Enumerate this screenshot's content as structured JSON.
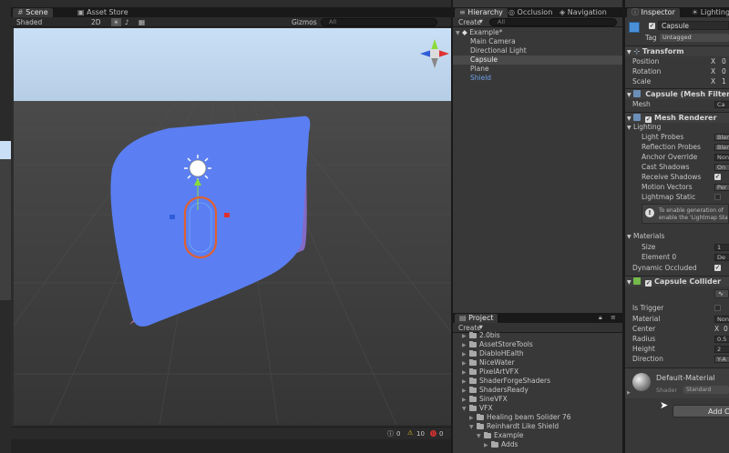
{
  "scene": {
    "tabs": [
      {
        "label": "Scene"
      },
      {
        "label": "Asset Store"
      }
    ],
    "toolbar": {
      "shading": "Shaded",
      "mode_2d": "2D",
      "gizmos": "Gizmos",
      "search_placeholder": "All"
    },
    "status_counts": {
      "messages": "0",
      "warnings": "10",
      "errors": "0"
    }
  },
  "hierarchy": {
    "tabs": [
      {
        "label": "Hierarchy"
      },
      {
        "label": "Occlusion"
      },
      {
        "label": "Navigation"
      }
    ],
    "create_label": "Create",
    "search_placeholder": "All",
    "scene_name": "Example*",
    "items": [
      {
        "label": "Main Camera"
      },
      {
        "label": "Directional Light"
      },
      {
        "label": "Capsule"
      },
      {
        "label": "Plane"
      },
      {
        "label": "Shield"
      }
    ]
  },
  "project": {
    "tab_label": "Project",
    "create_label": "Create",
    "folders": [
      {
        "label": "2.0bis"
      },
      {
        "label": "AssetStoreTools"
      },
      {
        "label": "DiabloHEalth"
      },
      {
        "label": "NiceWater"
      },
      {
        "label": "PixelArtVFX"
      },
      {
        "label": "ShaderForgeShaders"
      },
      {
        "label": "ShadersReady"
      },
      {
        "label": "SineVFX"
      },
      {
        "label": "VFX"
      },
      {
        "label": "Healing beam Solider 76"
      },
      {
        "label": "Reinhardt Like Shield"
      },
      {
        "label": "Example"
      },
      {
        "label": "Adds"
      }
    ]
  },
  "inspector": {
    "tabs": [
      {
        "label": "Inspector"
      },
      {
        "label": "Lighting"
      }
    ],
    "object_name": "Capsule",
    "tag_label": "Tag",
    "tag_value": "Untagged",
    "transform": {
      "title": "Transform",
      "rows": [
        {
          "label": "Position",
          "axis": "X",
          "value": "0"
        },
        {
          "label": "Rotation",
          "axis": "X",
          "value": "0"
        },
        {
          "label": "Scale",
          "axis": "X",
          "value": "1"
        }
      ]
    },
    "mesh_filter": {
      "title": "Capsule (Mesh Filter)",
      "mesh_label": "Mesh",
      "mesh_value": "Ca"
    },
    "mesh_renderer": {
      "title": "Mesh Renderer",
      "lighting_label": "Lighting",
      "rows": [
        {
          "label": "Light Probes",
          "value": "Blen"
        },
        {
          "label": "Reflection Probes",
          "value": "Blen"
        },
        {
          "label": "Anchor Override",
          "value": "None"
        },
        {
          "label": "Cast Shadows",
          "value": "On"
        },
        {
          "label": "Receive Shadows",
          "value": ""
        },
        {
          "label": "Motion Vectors",
          "value": "Per"
        },
        {
          "label": "Lightmap Static",
          "value": ""
        }
      ],
      "info_line1": "To enable generation of",
      "info_line2": "enable the 'Lightmap Sta",
      "materials_label": "Materials",
      "size_label": "Size",
      "size_value": "1",
      "element_label": "Element 0",
      "element_value": "De",
      "dynamic_occluded_label": "Dynamic Occluded"
    },
    "capsule_collider": {
      "title": "Capsule Collider",
      "rows": [
        {
          "label": "Is Trigger",
          "value": ""
        },
        {
          "label": "Material",
          "value": "None"
        },
        {
          "label": "Center",
          "axis": "X",
          "value": "0"
        },
        {
          "label": "Radius",
          "value": "0.5"
        },
        {
          "label": "Height",
          "value": "2"
        },
        {
          "label": "Direction",
          "value": "Y-A"
        }
      ]
    },
    "material": {
      "name": "Default-Material",
      "shader_label": "Shader",
      "shader_value": "Standard"
    },
    "add_component_label": "Add C"
  },
  "colors": {
    "shield": "#5b7ff2",
    "shield_edge": "#c87aa9",
    "sky": "#c9dff5",
    "ground": "#3b3b3b",
    "selection_outline": "#e0602e"
  }
}
